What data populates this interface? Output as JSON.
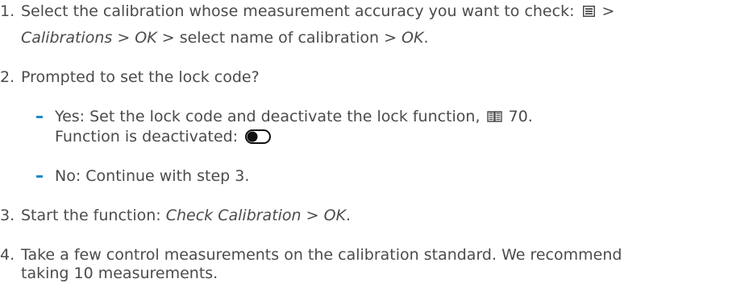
{
  "steps": {
    "s1": {
      "num": "1.",
      "part1": "Select the calibration whose measurement accuracy you want to check: ",
      "part2": " >",
      "calibrations": "Calibrations",
      "gt1": " > ",
      "ok1": "OK",
      "part3": " > select name of calibration > ",
      "ok2": "OK",
      "end": "."
    },
    "s2": {
      "num": "2.",
      "text": "Prompted to set the lock code?",
      "yes_text": "Yes: Set the lock code and deactivate the lock function, ",
      "yes_ref": " 70.",
      "yes_line2": "Function is deactivated: ",
      "no_text": "No: Continue with step 3."
    },
    "s3": {
      "num": "3.",
      "part1": "Start the function: ",
      "check_calibration": "Check Calibration",
      "gt": " > ",
      "ok": "OK",
      "end": "."
    },
    "s4": {
      "num": "4.",
      "line1": "Take a few control measurements on the calibration standard. We recommend",
      "line2": "taking 10 measurements."
    }
  },
  "icons": {
    "menu": "menu-icon",
    "book": "book-icon",
    "toggle": "toggle-off-icon"
  },
  "colors": {
    "text": "#4b4b4b",
    "bullet": "#1e88c8"
  }
}
